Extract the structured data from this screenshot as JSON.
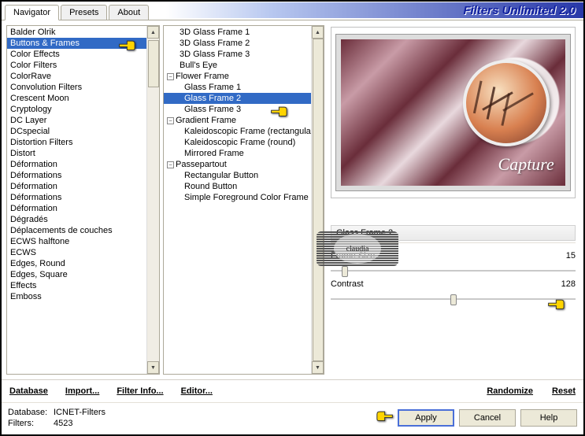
{
  "app": {
    "title": "Filters Unlimited 2.0"
  },
  "tabs": [
    "Navigator",
    "Presets",
    "About"
  ],
  "active_tab": 0,
  "categories": [
    "Balder Olrik",
    "Buttons & Frames",
    "Color Effects",
    "Color Filters",
    "ColorRave",
    "Convolution Filters",
    "Crescent Moon",
    "Cryptology",
    "DC Layer",
    "DCspecial",
    "Distortion Filters",
    "Distort",
    "Déformation",
    "Déformations",
    "Déformation",
    "Déformations",
    "Déformation",
    "Dégradés",
    "Déplacements de couches",
    "ECWS halftone",
    "ECWS",
    "Edges, Round",
    "Edges, Square",
    "Effects",
    "Emboss"
  ],
  "selected_category_index": 1,
  "filters": [
    {
      "label": "3D Glass Frame 1",
      "exp": null
    },
    {
      "label": "3D Glass Frame 2",
      "exp": null
    },
    {
      "label": "3D Glass Frame 3",
      "exp": null
    },
    {
      "label": "Bull's Eye",
      "exp": null
    },
    {
      "label": "Flower Frame",
      "exp": "minus"
    },
    {
      "label": "Glass Frame 1",
      "exp": null,
      "indent": true
    },
    {
      "label": "Glass Frame 2",
      "exp": null,
      "indent": true
    },
    {
      "label": "Glass Frame 3",
      "exp": null,
      "indent": true
    },
    {
      "label": "Gradient Frame",
      "exp": "minus"
    },
    {
      "label": "Kaleidoscopic Frame (rectangular)",
      "exp": null,
      "indent": true
    },
    {
      "label": "Kaleidoscopic Frame (round)",
      "exp": null,
      "indent": true
    },
    {
      "label": "Mirrored Frame",
      "exp": null,
      "indent": true
    },
    {
      "label": "Passepartout",
      "exp": "minus"
    },
    {
      "label": "Rectangular Button",
      "exp": null,
      "indent": true
    },
    {
      "label": "Round Button",
      "exp": null,
      "indent": true
    },
    {
      "label": "Simple Foreground Color Frame",
      "exp": null,
      "indent": true
    }
  ],
  "selected_filter_index": 6,
  "selected_filter_name": "Glass Frame 2",
  "preview_caption": "Capture",
  "watermark_text": "claudia",
  "params": [
    {
      "name": "Frame Size",
      "value": 15,
      "min": 0,
      "max": 255
    },
    {
      "name": "Contrast",
      "value": 128,
      "min": 0,
      "max": 255
    }
  ],
  "toolbar": {
    "database": "Database",
    "import": "Import...",
    "filter_info": "Filter Info...",
    "editor": "Editor...",
    "randomize": "Randomize",
    "reset": "Reset"
  },
  "footer": {
    "database_label": "Database:",
    "database_value": "ICNET-Filters",
    "filters_label": "Filters:",
    "filters_value": "4523",
    "apply": "Apply",
    "cancel": "Cancel",
    "help": "Help"
  }
}
